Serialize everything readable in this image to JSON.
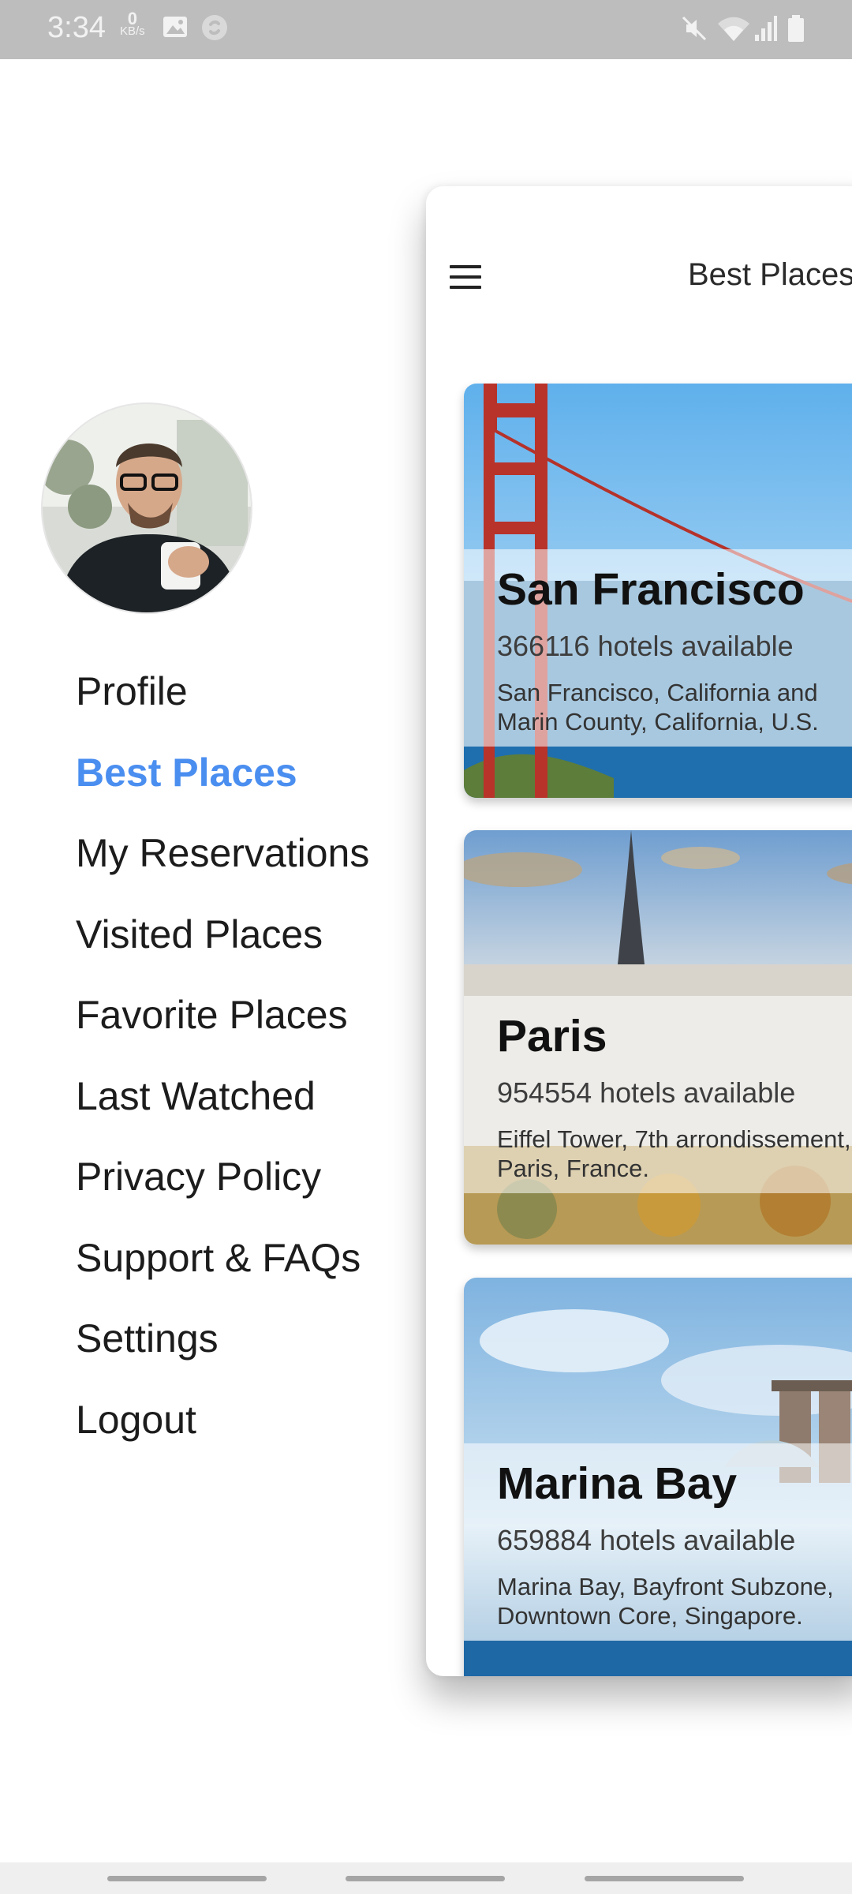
{
  "status_bar": {
    "time": "3:34",
    "net_speed_value": "0",
    "net_speed_unit": "KB/s",
    "icons": [
      "gallery-icon",
      "shazam-icon",
      "mute-icon",
      "wifi-icon",
      "signal-icon",
      "battery-icon"
    ]
  },
  "drawer": {
    "items": [
      {
        "label": "Profile"
      },
      {
        "label": "Best Places",
        "active": true
      },
      {
        "label": "My Reservations"
      },
      {
        "label": "Visited Places"
      },
      {
        "label": "Favorite Places"
      },
      {
        "label": "Last Watched"
      },
      {
        "label": "Privacy Policy"
      },
      {
        "label": "Support & FAQs"
      },
      {
        "label": "Settings"
      },
      {
        "label": "Logout"
      }
    ]
  },
  "main": {
    "title": "Best Places",
    "cards": [
      {
        "title": "San Francisco",
        "hotels": "366116 hotels available",
        "description": " San Francisco, California and Marin County, California, U.S."
      },
      {
        "title": "Paris",
        "hotels": "954554 hotels available",
        "description": "Eiffel Tower, 7th arrondissement, Paris, France."
      },
      {
        "title": "Marina Bay",
        "hotels": "659884 hotels available",
        "description": "Marina Bay,  Bayfront Subzone, Downtown Core, Singapore."
      }
    ]
  },
  "colors": {
    "accent": "#4a8ef0",
    "status_bar": "#bdbdbd"
  }
}
